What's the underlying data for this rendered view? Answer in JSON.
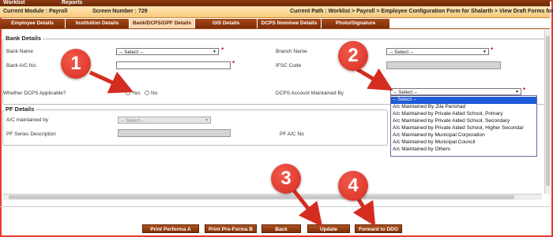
{
  "menubar": {
    "item1": "Worklist",
    "item2": "Reports"
  },
  "infobar": {
    "current_module": "Current Module : Payroll",
    "screen_number": "Screen Number : 729",
    "current_path": "Current Path : Worklist > Payroll > Employee Configuration Form for Shalarth > View Draft Forms for Shalarth"
  },
  "tabs": [
    {
      "label": "Employee Details"
    },
    {
      "label": "Institution Details"
    },
    {
      "label": "Bank/DCPS/GPF Details"
    },
    {
      "label": "GIS Details"
    },
    {
      "label": "DCPS Nominee Details"
    },
    {
      "label": "Photo/Signature"
    }
  ],
  "bank_details": {
    "title": "Bank Details",
    "bank_name_label": "Bank Name",
    "bank_name_value": "-- Select --",
    "branch_name_label": "Branch Name",
    "branch_name_value": "-- Select --",
    "bank_ac_label": "Bank A/C No.",
    "ifsc_label": "IFSC Code",
    "dcps_applicable_label": "Whether DCPS Applicable?",
    "yes_label": "Yes",
    "no_label": "No",
    "dcps_maintained_label": "DCPS Account Maintained By",
    "dcps_maintained_value": "-- Select --",
    "required_mark": "*"
  },
  "dcps_options": [
    "-- Select --",
    "A/c Maintained By Zila Parishad",
    "A/c Maintained by Private Aided School, Primary",
    "A/c Maintained by Private Aided School, Secondary",
    "A/c Maintained by Private Aided School, Higher Secondar",
    "A/c Maintained by Municipal Corporation",
    "A/c Maintained by Municipal Council",
    "A/c Maintained by Others"
  ],
  "pf_details": {
    "title": "PF Details",
    "ac_maintained_label": "A/C maintained by",
    "ac_maintained_value": "-- Select --",
    "pf_series_label": "PF Series Description",
    "pf_ac_label": "PF A/C No"
  },
  "buttons": {
    "print_performa_a": "Print Performa A",
    "print_pro_forma_b": "Print Pro-Forma B",
    "back": "Back",
    "update": "Update",
    "forward": "Forward to DDO"
  },
  "badges": [
    "1",
    "2",
    "3",
    "4"
  ],
  "colors": {
    "accent": "#e53a2f",
    "tab": "#7c2d08",
    "highlight": "#1e5bd6"
  },
  "icons": {
    "dropdown_arrow": "chevron-down-icon"
  }
}
